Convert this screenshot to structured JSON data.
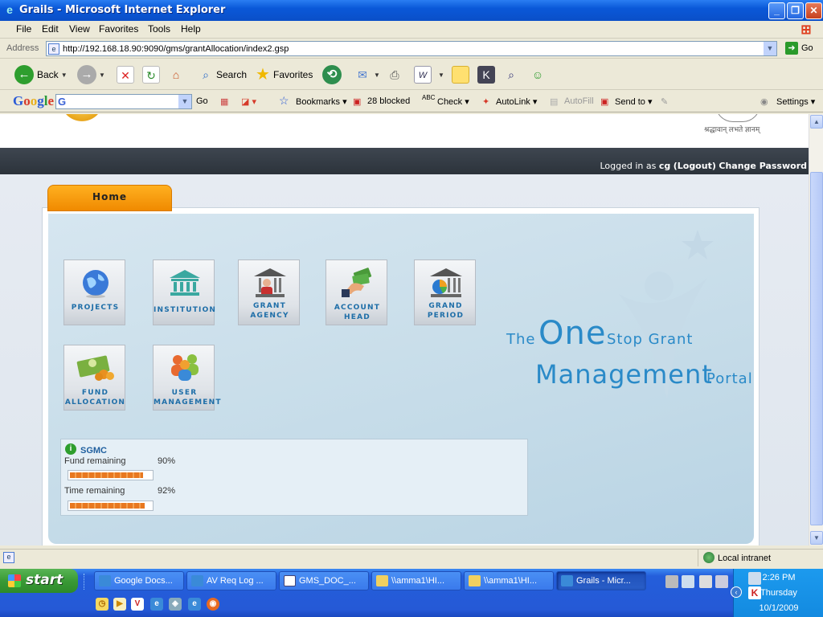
{
  "window": {
    "title": "Grails - Microsoft Internet Explorer"
  },
  "menu": [
    "File",
    "Edit",
    "View",
    "Favorites",
    "Tools",
    "Help"
  ],
  "address": {
    "label": "Address",
    "url": "http://192.168.18.90:9090/gms/grantAllocation/index2.gsp",
    "go": "Go"
  },
  "toolbar": {
    "back": "Back",
    "search": "Search",
    "favorites": "Favorites"
  },
  "google_bar": {
    "logo": "Google",
    "go": "Go",
    "bookmarks": "Bookmarks",
    "blocked": "28 blocked",
    "check": "Check",
    "autolink": "AutoLink",
    "autofill": "AutoFill",
    "send_to": "Send to",
    "settings": "Settings"
  },
  "page": {
    "emblem_text": "श्रद्धावान् लभते ज्ञानम्",
    "login": {
      "prefix": "Logged in as ",
      "user": "cg",
      "logout": "(Logout)",
      "change_password": "Change Password"
    },
    "tab_home": "Home",
    "tiles": [
      {
        "name": "projects",
        "line1": "PROJECTS",
        "line2": "",
        "icon": "globe-icon"
      },
      {
        "name": "institution",
        "line1": "INSTITUTION",
        "line2": "",
        "icon": "building-icon"
      },
      {
        "name": "grant-agency",
        "line1": "GRANT",
        "line2": "AGENCY",
        "icon": "agency-building-icon"
      },
      {
        "name": "account-head",
        "line1": "ACCOUNT",
        "line2": "HEAD",
        "icon": "money-hand-icon"
      },
      {
        "name": "grant-period",
        "line1": "GRAND",
        "line2": "PERIOD",
        "icon": "period-chart-icon"
      },
      {
        "name": "fund-allocation",
        "line1": "FUND",
        "line2": "ALLOCATION",
        "icon": "money-stack-icon"
      },
      {
        "name": "user-management",
        "line1": "USER",
        "line2": "MANAGEMENT",
        "icon": "users-icon"
      }
    ],
    "tagline": {
      "the": "The",
      "one": "One",
      "stop_grant": "Stop Grant",
      "management": "Management",
      "portal": "Portal"
    },
    "status": {
      "title": "SGMC",
      "fund_label": "Fund remaining",
      "fund_value": "90%",
      "fund_fraction": 0.9,
      "time_label": "Time remaining",
      "time_value": "92%",
      "time_fraction": 0.92
    }
  },
  "statusbar": {
    "zone": "Local intranet"
  },
  "taskbar": {
    "start": "start",
    "tasks": [
      "Google Docs...",
      "AV Req Log ...",
      "GMS_DOC_...",
      "\\\\amma1\\HI...",
      "\\\\amma1\\HI...",
      "Grails - Micr..."
    ],
    "time": "2:26 PM",
    "day": "Thursday",
    "date": "10/1/2009"
  },
  "colors": {
    "accent_orange": "#f08a00",
    "portal_blue": "#2a8ac8",
    "xp_blue": "#245edb"
  }
}
